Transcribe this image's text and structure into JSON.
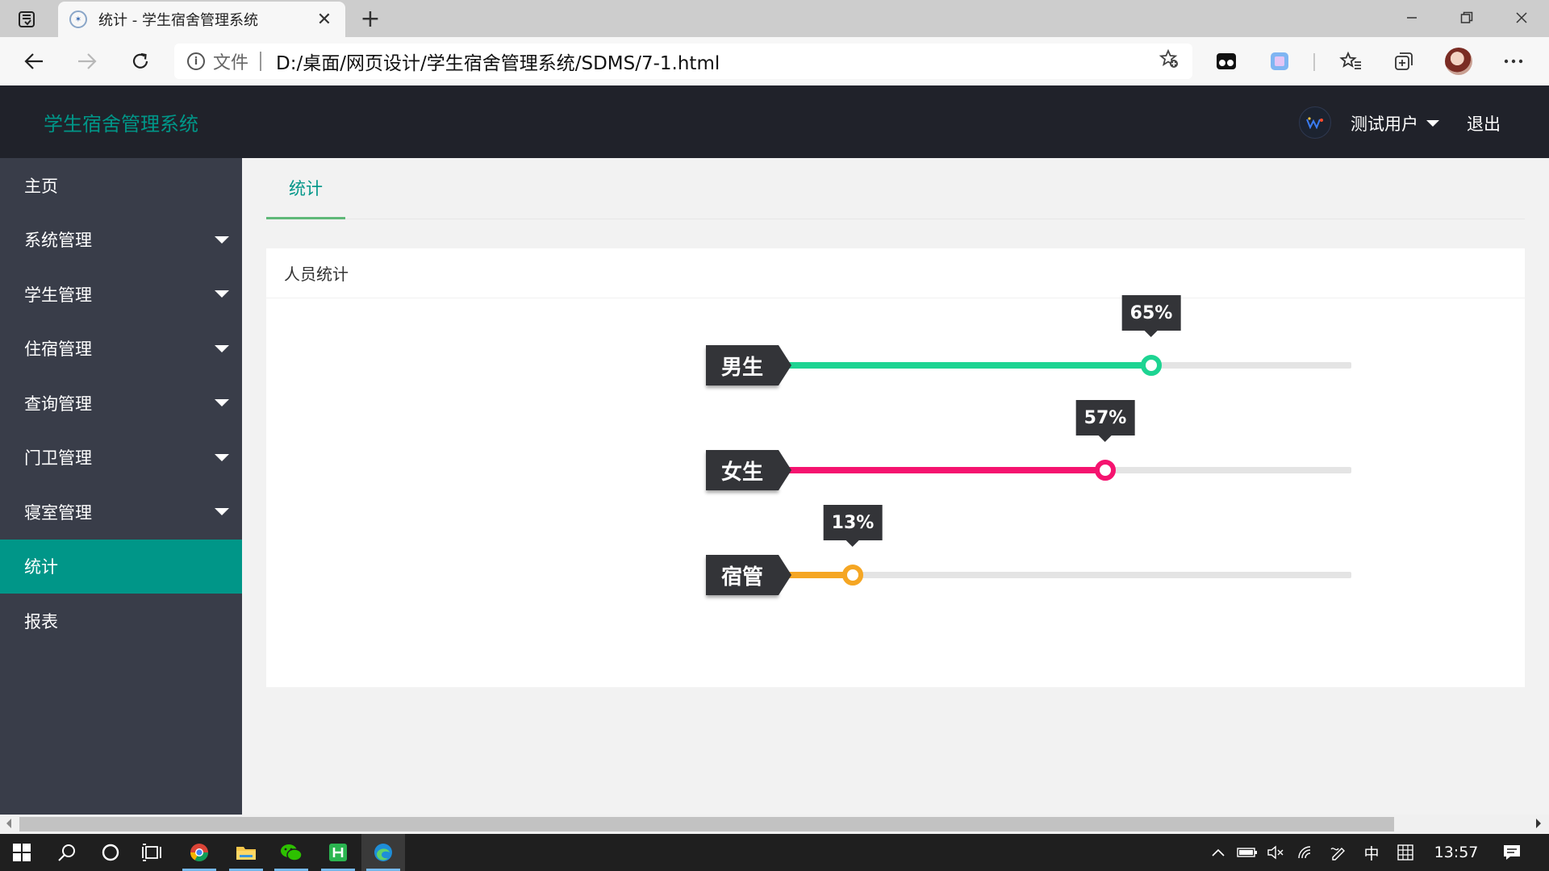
{
  "browser": {
    "tab_title": "统计 - 学生宿舍管理系统",
    "tab_close": "✕",
    "new_tab": "+",
    "omnibox_label": "文件",
    "url": "D:/桌面/网页设计/学生宿舍管理系统/SDMS/7-1.html"
  },
  "app": {
    "title": "学生宿舍管理系统",
    "user_name": "测试用户",
    "logout": "退出",
    "accent_color": "#009688"
  },
  "sidebar": {
    "items": [
      {
        "label": "主页"
      },
      {
        "label": "系统管理"
      },
      {
        "label": "学生管理"
      },
      {
        "label": "住宿管理"
      },
      {
        "label": "查询管理"
      },
      {
        "label": "门卫管理"
      },
      {
        "label": "寝室管理"
      },
      {
        "label": "统计"
      },
      {
        "label": "报表"
      }
    ],
    "active_index": 7
  },
  "content": {
    "tab": "统计",
    "card_title": "人员统计"
  },
  "chart_data": {
    "type": "bar",
    "categories": [
      "男生",
      "女生",
      "宿管"
    ],
    "values": [
      65,
      57,
      13
    ],
    "value_labels": [
      "65%",
      "57%",
      "13%"
    ],
    "colors": [
      "#1dd492",
      "#f5136f",
      "#f5a623"
    ],
    "ylim": [
      0,
      100
    ]
  },
  "taskbar": {
    "time": "13:57",
    "ime": "中"
  }
}
